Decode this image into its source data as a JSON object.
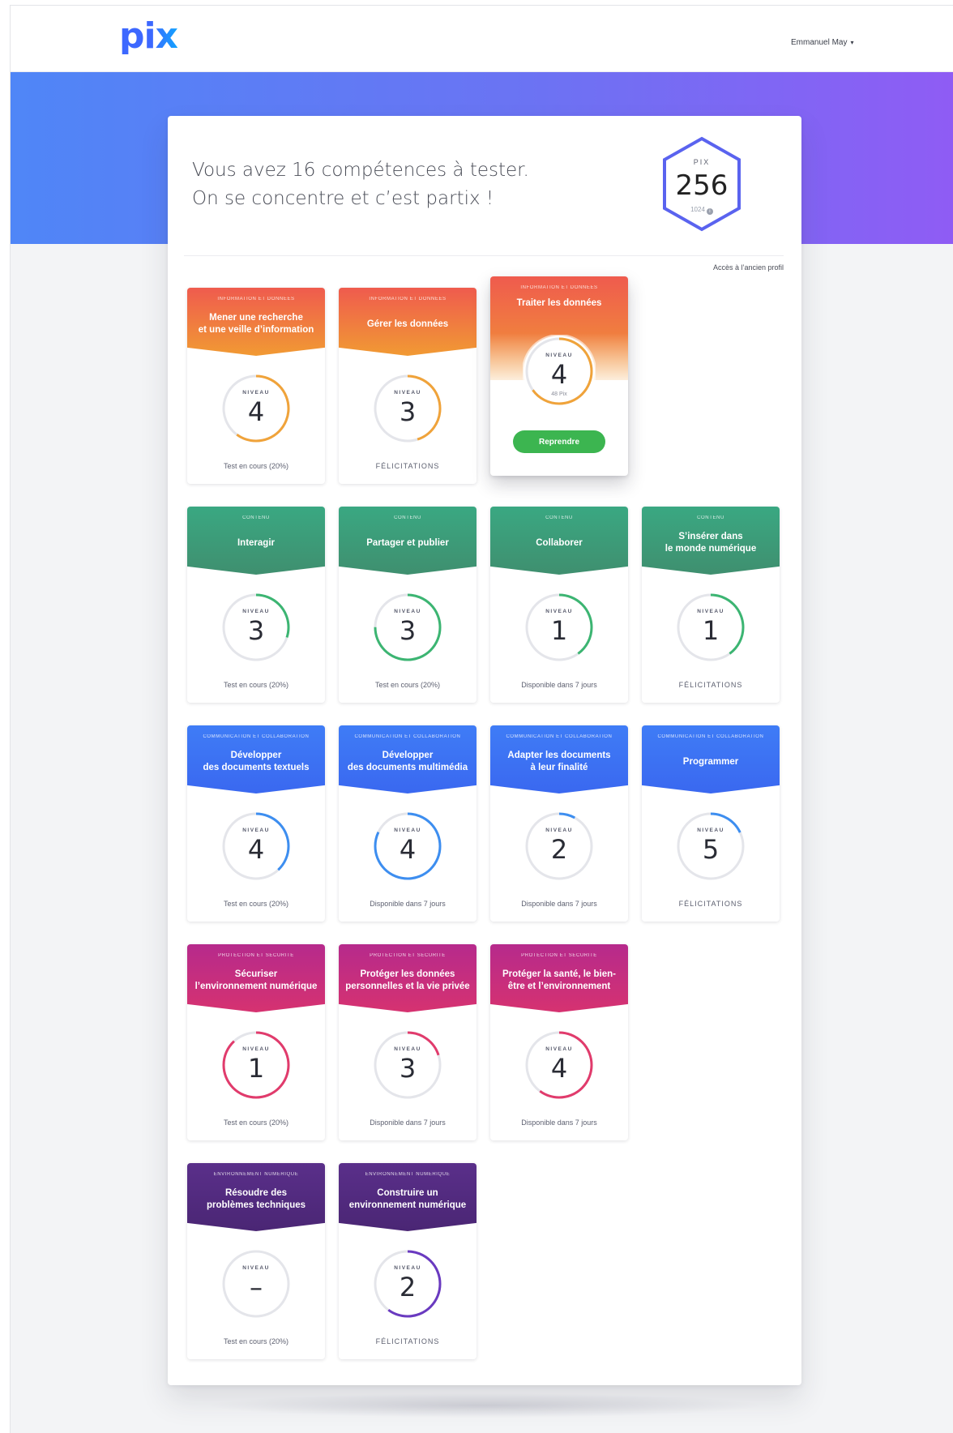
{
  "header": {
    "logo": "pix",
    "user_name": "Emmanuel May"
  },
  "intro": {
    "line1": "Vous avez 16 compétences à tester.",
    "line2": "On se concentre et c’est partix !"
  },
  "score": {
    "label": "PIX",
    "value": "256",
    "max": "1024",
    "info_icon": "info-icon"
  },
  "old_profile_link": "Accès à l’ancien profil",
  "colors": {
    "orange_top": "#ef5b4e",
    "orange_bottom": "#f19a33",
    "green_top": "#3aa882",
    "green_bottom": "#3f8f6f",
    "blue_top": "#3f7cf6",
    "blue_bottom": "#3a68f0",
    "magenta_top": "#b62a8c",
    "magenta_bottom": "#d63270",
    "purple_top": "#5a2f8a",
    "purple_bottom": "#4a2674",
    "resume": "#3cb550",
    "orange_ring": "#f0a33a",
    "green_ring": "#3cb572",
    "blue_ring": "#3d8ef0",
    "pink_ring": "#e13b6c",
    "purple_ring": "#6a3ac0"
  },
  "cards": [
    {
      "domain": "Information et données",
      "name": "Mener une recherche\net une veille d’information",
      "level": "4",
      "progress": 0.6,
      "status": "Test en cours (20%)",
      "theme": "orange"
    },
    {
      "domain": "Information et données",
      "name": "Gérer les données",
      "level": "3",
      "progress": 0.45,
      "status": "FÉLICITATIONS",
      "theme": "orange"
    },
    {
      "domain": "Information et données",
      "name": "Traiter les données",
      "level": "4",
      "level_sub": "48 Pix",
      "progress": 0.65,
      "status": "",
      "button": "Reprendre",
      "theme": "orange",
      "raised": true
    },
    {
      "domain": "Contenu",
      "name": "Interagir",
      "level": "3",
      "progress": 0.3,
      "status": "Test en cours (20%)",
      "theme": "green"
    },
    {
      "domain": "Contenu",
      "name": "Partager et publier",
      "level": "3",
      "progress": 0.75,
      "status": "Test en cours (20%)",
      "theme": "green"
    },
    {
      "domain": "Contenu",
      "name": "Collaborer",
      "level": "1",
      "progress": 0.4,
      "status": "Disponible dans 7 jours",
      "theme": "green"
    },
    {
      "domain": "Contenu",
      "name": "S’insérer dans\nle monde numérique",
      "level": "1",
      "progress": 0.4,
      "status": "FÉLICITATIONS",
      "theme": "green"
    },
    {
      "domain": "Communication et collaboration",
      "name": "Développer\ndes documents textuels",
      "level": "4",
      "progress": 0.38,
      "status": "Test en cours (20%)",
      "theme": "blue"
    },
    {
      "domain": "Communication et collaboration",
      "name": "Développer\ndes documents multimédia",
      "level": "4",
      "progress": 0.82,
      "status": "Disponible dans 7 jours",
      "theme": "blue"
    },
    {
      "domain": "Communication et collaboration",
      "name": "Adapter les documents\nà leur finalité",
      "level": "2",
      "progress": 0.08,
      "status": "Disponible dans 7 jours",
      "theme": "blue"
    },
    {
      "domain": "Communication et collaboration",
      "name": "Programmer",
      "level": "5",
      "progress": 0.18,
      "status": "FÉLICITATIONS",
      "theme": "blue"
    },
    {
      "domain": "Protection et sécurité",
      "name": "Sécuriser\nl’environnement numérique",
      "level": "1",
      "progress": 0.88,
      "status": "Test en cours (20%)",
      "theme": "magenta"
    },
    {
      "domain": "Protection et sécurité",
      "name": "Protéger les données\npersonnelles et la vie privée",
      "level": "3",
      "progress": 0.2,
      "status": "Disponible dans 7 jours",
      "theme": "magenta"
    },
    {
      "domain": "Protection et sécurité",
      "name": "Protéger la santé, le bien-\nêtre et l’environnement",
      "level": "4",
      "progress": 0.6,
      "status": "Disponible dans 7 jours",
      "theme": "magenta"
    },
    {
      "domain": "Environnement numérique",
      "name": "Résoudre des\nproblèmes techniques",
      "level": "–",
      "progress": 0,
      "status": "Test en cours (20%)",
      "theme": "purple"
    },
    {
      "domain": "Environnement numérique",
      "name": "Construire un\nenvironnement numérique",
      "level": "2",
      "progress": 0.6,
      "status": "FÉLICITATIONS",
      "theme": "purple"
    }
  ],
  "ring_label": "NIVEAU"
}
